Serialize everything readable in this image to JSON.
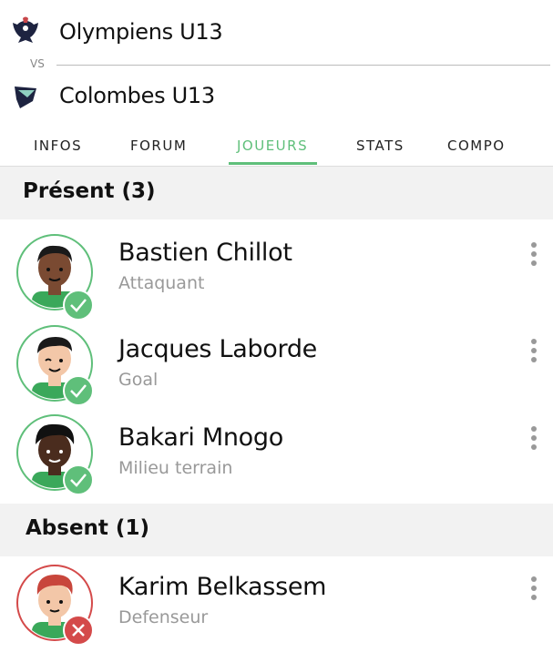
{
  "match": {
    "home_team": "Olympiens U13",
    "vs": "VS",
    "away_team": "Colombes U13"
  },
  "tabs": [
    {
      "label": "INFOS",
      "active": false
    },
    {
      "label": "FORUM",
      "active": false
    },
    {
      "label": "JOUEURS",
      "active": true
    },
    {
      "label": "STATS",
      "active": false
    },
    {
      "label": "COMPO",
      "active": false
    }
  ],
  "sections": {
    "present": {
      "title": "Présent (3)",
      "players": [
        {
          "name": "Bastien Chillot",
          "role": "Attaquant",
          "status": "check"
        },
        {
          "name": "Jacques Laborde",
          "role": "Goal",
          "status": "check"
        },
        {
          "name": "Bakari Mnogo",
          "role": "Milieu terrain",
          "status": "check"
        }
      ]
    },
    "absent": {
      "title": "Absent (1)",
      "players": [
        {
          "name": "Karim Belkassem",
          "role": "Defenseur",
          "status": "cross"
        }
      ]
    }
  },
  "colors": {
    "accent_green": "#5fbf7a",
    "absent_red": "#d44a4a",
    "section_bg": "#f2f2f2"
  },
  "icons": {
    "home_logo": "eagle-crest-icon",
    "away_logo": "dove-shield-icon",
    "menu": "more-vertical-icon",
    "present_badge": "check-icon",
    "absent_badge": "cross-icon"
  }
}
